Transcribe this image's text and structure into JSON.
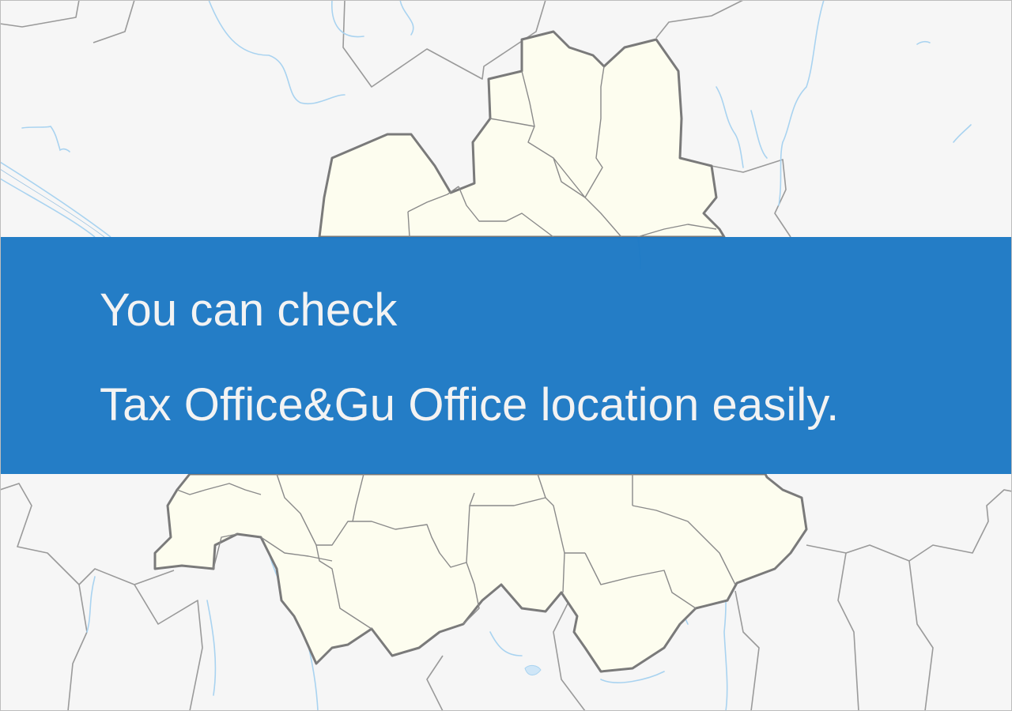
{
  "banner": {
    "line1": "You can check",
    "line2": "Tax Office&Gu Office location easily."
  },
  "colors": {
    "background": "#f6f6f6",
    "city_fill": "#fdfdef",
    "district_border": "#8a8a8a",
    "city_border": "#7a7a7a",
    "water": "#a9d3f0",
    "banner": "#1b78c4",
    "banner_text": "#f3f3f3"
  },
  "icons": {
    "map": "seoul-district-map"
  }
}
